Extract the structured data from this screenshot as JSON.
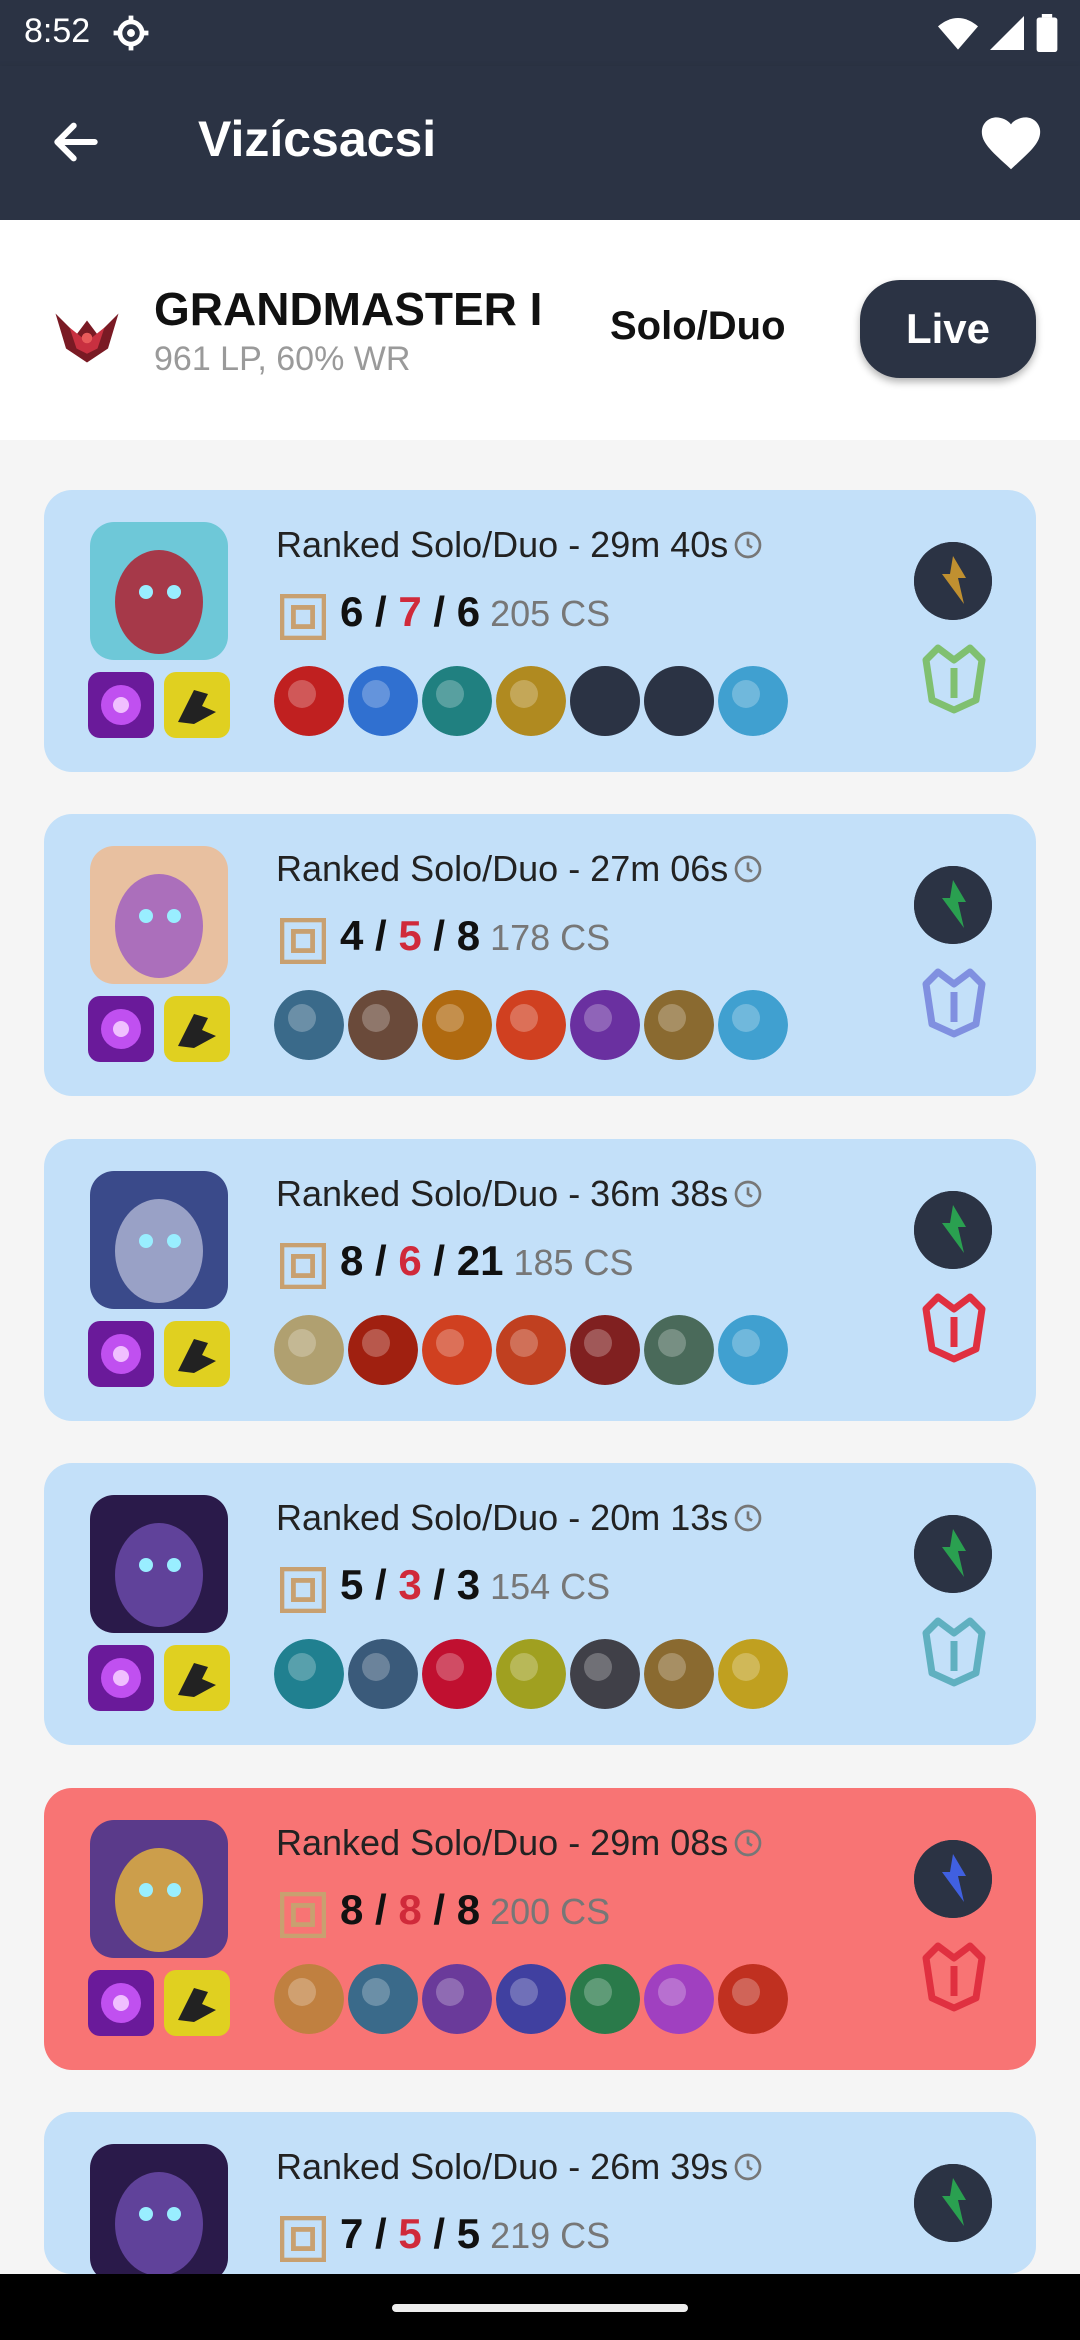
{
  "status_bar": {
    "time": "8:52"
  },
  "app_bar": {
    "title": "Vizícsacsi"
  },
  "rank": {
    "tier": "GRANDMASTER I",
    "stats": "961 LP, 60% WR",
    "queue": "Solo/Duo",
    "live_label": "Live"
  },
  "matches": [
    {
      "queue": "Ranked Solo/Duo",
      "duration": " - 29m 40s",
      "kills": "6",
      "deaths": "7",
      "assists": "6",
      "cs": "205 CS",
      "result": "win"
    },
    {
      "queue": "Ranked Solo/Duo",
      "duration": " - 27m 06s",
      "kills": "4",
      "deaths": "5",
      "assists": "8",
      "cs": "178 CS",
      "result": "win"
    },
    {
      "queue": "Ranked Solo/Duo",
      "duration": " - 36m 38s",
      "kills": "8",
      "deaths": "6",
      "assists": "21",
      "cs": "185 CS",
      "result": "win"
    },
    {
      "queue": "Ranked Solo/Duo",
      "duration": " - 20m 13s",
      "kills": "5",
      "deaths": "3",
      "assists": "3",
      "cs": "154 CS",
      "result": "win"
    },
    {
      "queue": "Ranked Solo/Duo",
      "duration": " - 29m 08s",
      "kills": "8",
      "deaths": "8",
      "assists": "8",
      "cs": "200 CS",
      "result": "loss"
    },
    {
      "queue": "Ranked Solo/Duo",
      "duration": " - 26m 39s",
      "kills": "7",
      "deaths": "5",
      "assists": "5",
      "cs": "219 CS",
      "result": "win"
    }
  ],
  "colors": {
    "header": "#2b3344",
    "win_card": "#c3e0f9",
    "loss_card": "#f87474",
    "deaths": "#d02a3a"
  }
}
